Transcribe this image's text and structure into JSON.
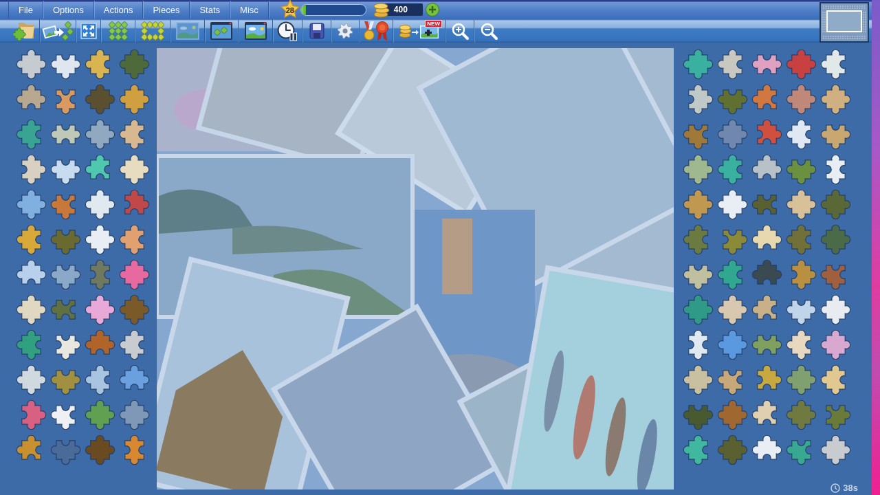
{
  "menu": [
    "File",
    "Options",
    "Actions",
    "Pieces",
    "Stats",
    "Misc"
  ],
  "player": {
    "rank": "28",
    "xp_bar": {
      "level": 0.08
    }
  },
  "coins": {
    "amount": "400"
  },
  "toolbar": {
    "new_badge": "NEW"
  },
  "left_tray": {
    "pieces": [
      {
        "color": "#c6cbd0"
      },
      {
        "color": "#dfe6f0"
      },
      {
        "color": "#d9b450"
      },
      {
        "color": "#4f6a3a"
      },
      {
        "color": "#b8a890"
      },
      {
        "color": "#d89a60"
      },
      {
        "color": "#5a5030"
      },
      {
        "color": "#d0a040"
      },
      {
        "color": "#3aa494"
      },
      {
        "color": "#c0c8b8"
      },
      {
        "color": "#90a8c0"
      },
      {
        "color": "#d8b890"
      },
      {
        "color": "#d8d0c0"
      },
      {
        "color": "#c8dcf0"
      },
      {
        "color": "#50c8b0"
      },
      {
        "color": "#e8dcc0"
      },
      {
        "color": "#7fb0e0"
      },
      {
        "color": "#c87838"
      },
      {
        "color": "#e0e8f0"
      },
      {
        "color": "#c04848"
      },
      {
        "color": "#d8a838"
      },
      {
        "color": "#6a6a30"
      },
      {
        "color": "#e8eef4"
      },
      {
        "color": "#e0a070"
      },
      {
        "color": "#b8d0ec"
      },
      {
        "color": "#8aa8c8"
      },
      {
        "color": "#707860"
      },
      {
        "color": "#e868a0"
      },
      {
        "color": "#e0d8c0"
      },
      {
        "color": "#607040"
      },
      {
        "color": "#e8a8d8"
      },
      {
        "color": "#7a5a28"
      },
      {
        "color": "#30a080"
      },
      {
        "color": "#e8e8e0"
      },
      {
        "color": "#b0642a"
      },
      {
        "color": "#c8ccd0"
      },
      {
        "color": "#d0d8e0"
      },
      {
        "color": "#a09040"
      },
      {
        "color": "#a8c4e0"
      },
      {
        "color": "#6aa0e0"
      },
      {
        "color": "#d86080"
      },
      {
        "color": "#eef0f4"
      },
      {
        "color": "#60a050"
      },
      {
        "color": "#8098b8"
      },
      {
        "color": "#c89030"
      },
      {
        "color": "#4a6a9a"
      },
      {
        "color": "#6a4a20"
      },
      {
        "color": "#d88830"
      }
    ]
  },
  "right_tray": {
    "pieces": [
      {
        "color": "#3ab0a0"
      },
      {
        "color": "#c8c8c0"
      },
      {
        "color": "#e0a0c0"
      },
      {
        "color": "#c84040"
      },
      {
        "color": "#e0e8e8"
      },
      {
        "color": "#c0c8c8"
      },
      {
        "color": "#607030"
      },
      {
        "color": "#d07840"
      },
      {
        "color": "#c08878"
      },
      {
        "color": "#d0b080"
      },
      {
        "color": "#a07838"
      },
      {
        "color": "#7088b0"
      },
      {
        "color": "#d05040"
      },
      {
        "color": "#e0e8f4"
      },
      {
        "color": "#c8a870"
      },
      {
        "color": "#a0b890"
      },
      {
        "color": "#3ab0a0"
      },
      {
        "color": "#b8c0c8"
      },
      {
        "color": "#6a9040"
      },
      {
        "color": "#e8eef4"
      },
      {
        "color": "#c09850"
      },
      {
        "color": "#e8eef4"
      },
      {
        "color": "#5a6030"
      },
      {
        "color": "#d8c098"
      },
      {
        "color": "#5a6838"
      },
      {
        "color": "#6a7a40"
      },
      {
        "color": "#8a8a38"
      },
      {
        "color": "#e8d8b0"
      },
      {
        "color": "#707038"
      },
      {
        "color": "#4a6a48"
      },
      {
        "color": "#c0c0a0"
      },
      {
        "color": "#30a890"
      },
      {
        "color": "#3a4a50"
      },
      {
        "color": "#b89040"
      },
      {
        "color": "#a06040"
      },
      {
        "color": "#309a88"
      },
      {
        "color": "#d8c8b0"
      },
      {
        "color": "#c8b088"
      },
      {
        "color": "#c0d4ea"
      },
      {
        "color": "#e8ecf0"
      },
      {
        "color": "#e0e8f0"
      },
      {
        "color": "#5a98e0"
      },
      {
        "color": "#80a060"
      },
      {
        "color": "#e8d8c0"
      },
      {
        "color": "#d8a8d0"
      },
      {
        "color": "#c8c0a0"
      },
      {
        "color": "#c8a878"
      },
      {
        "color": "#c8a840"
      },
      {
        "color": "#80a070"
      },
      {
        "color": "#e0c890"
      },
      {
        "color": "#4a5a30"
      },
      {
        "color": "#a06830"
      },
      {
        "color": "#e0d0b0"
      },
      {
        "color": "#707a40"
      },
      {
        "color": "#6a7a38"
      },
      {
        "color": "#40b8a0"
      },
      {
        "color": "#5a6030"
      },
      {
        "color": "#e8eef4"
      },
      {
        "color": "#38a890"
      },
      {
        "color": "#c8ccd0"
      }
    ]
  },
  "timer": "38s"
}
